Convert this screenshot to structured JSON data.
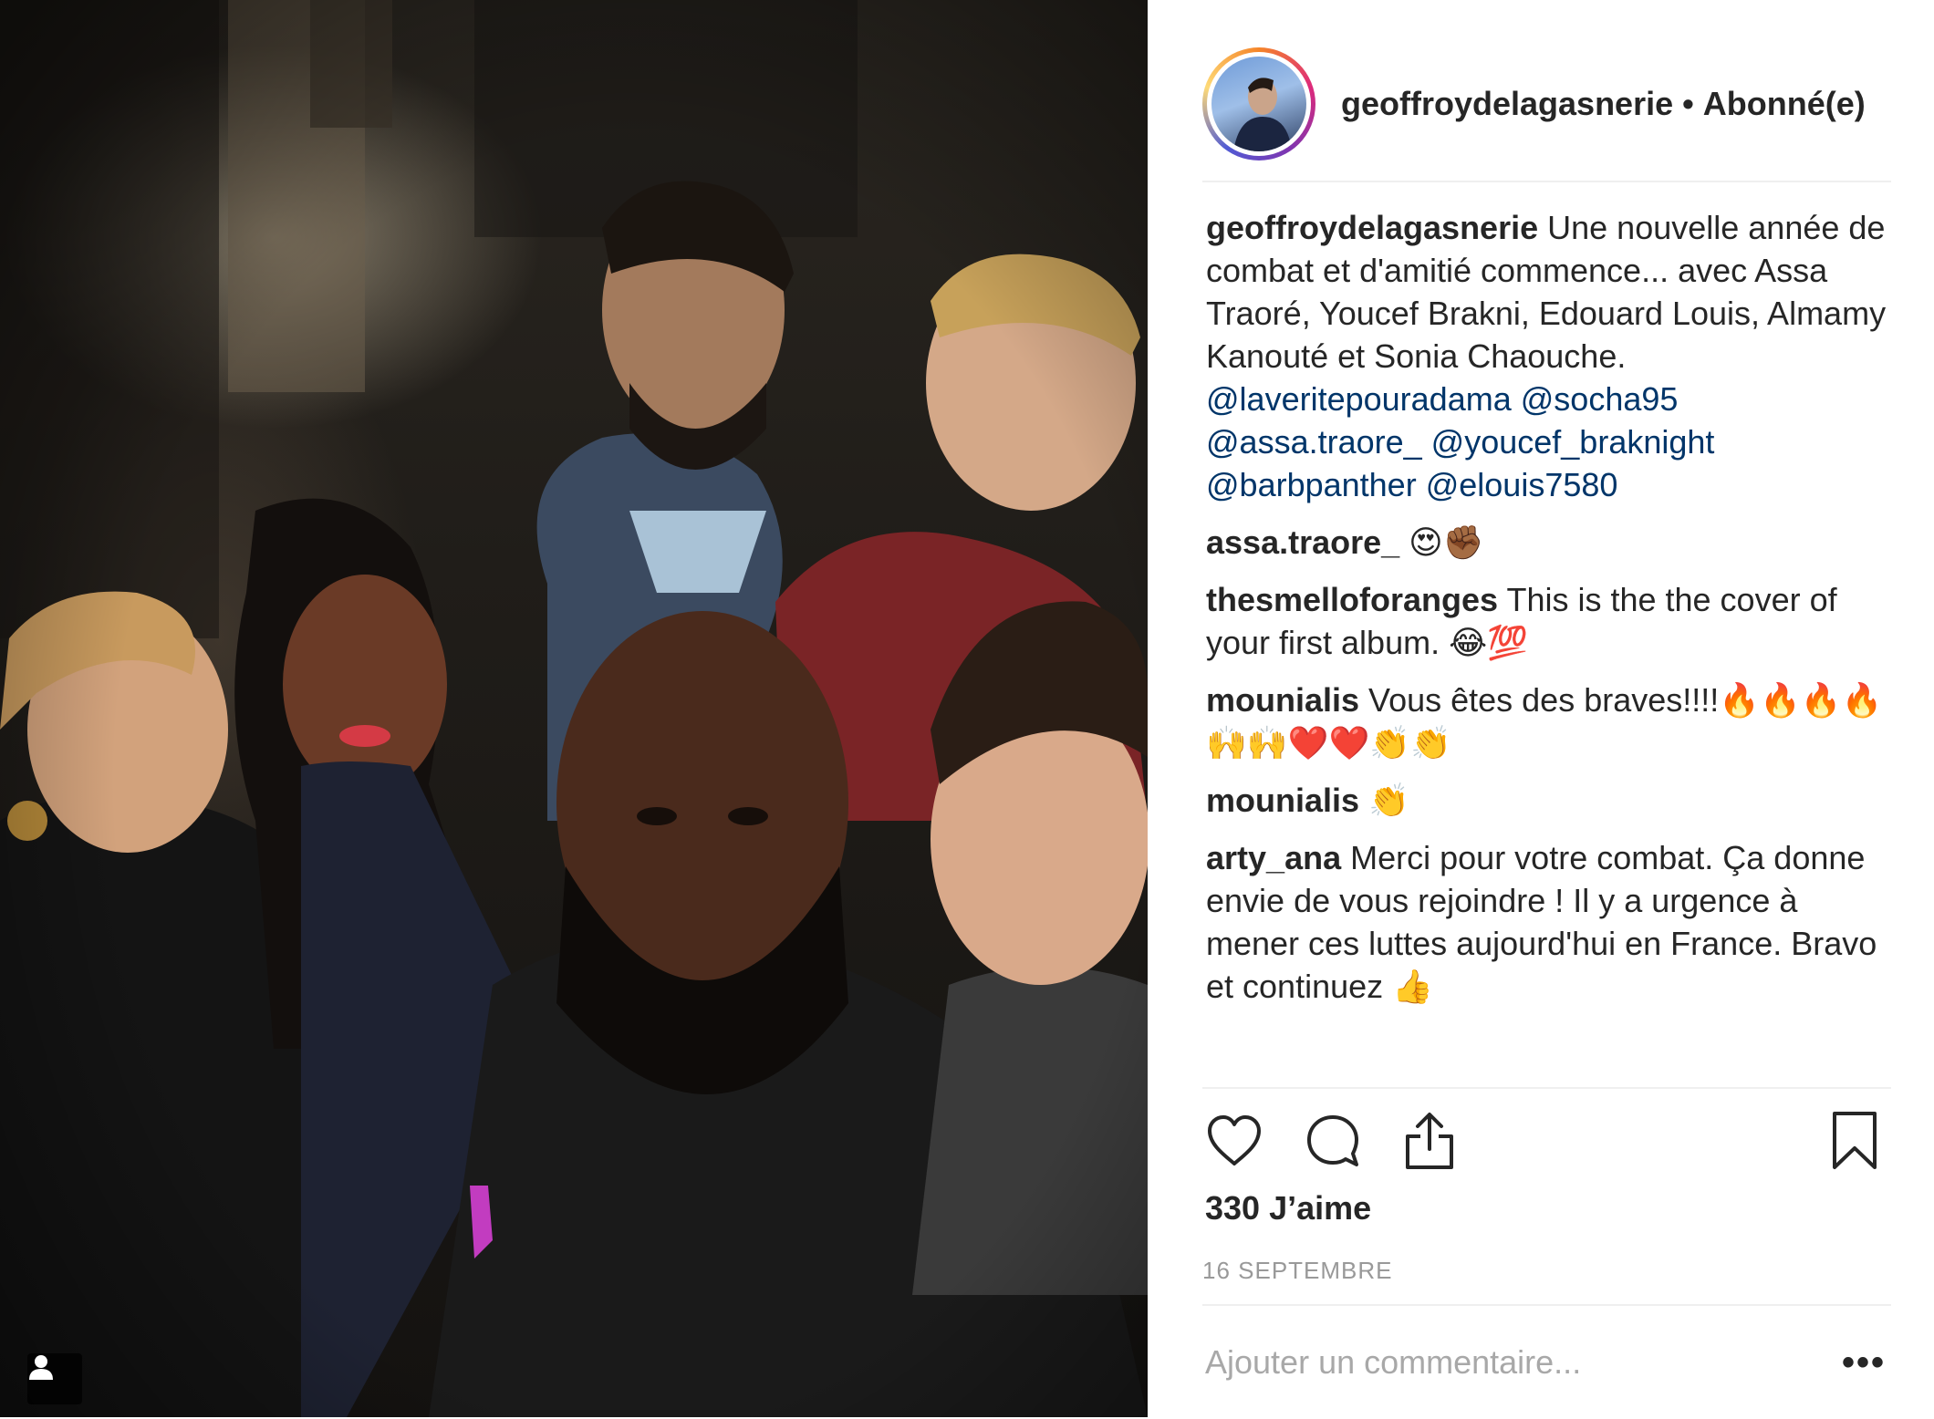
{
  "post": {
    "photo_alt": "Selfie de groupe de nuit",
    "author": "geoffroydelagasnerie",
    "separator": "•",
    "follow_status": "Abonné(e)",
    "caption": {
      "user": "geoffroydelagasnerie",
      "text": "Une nouvelle année de combat et d'amitié commence... avec Assa Traoré, Youcef Brakni, Edouard Louis, Almamy Kanouté et Sonia Chaouche.",
      "mentions": [
        "@laveritepouradama",
        "@socha95",
        "@assa.traore_",
        "@youcef_braknight",
        "@barbpanther",
        "@elouis7580"
      ]
    },
    "comments": [
      {
        "user": "assa.traore_",
        "text": "😍✊🏾"
      },
      {
        "user": "thesmelloforanges",
        "text": "This is the the cover of your first album. 😂💯"
      },
      {
        "user": "mounialis",
        "text": "Vous êtes des braves!!!!🔥🔥🔥🔥🙌🙌❤️❤️👏👏"
      },
      {
        "user": "mounialis",
        "text": "👏"
      },
      {
        "user": "arty_ana",
        "text": "Merci pour votre combat. Ça donne envie de vous rejoindre ! Il y a urgence à mener ces luttes aujourd'hui en France. Bravo et continuez 👍"
      }
    ],
    "likes": "330 J’aime",
    "date": "16 SEPTEMBRE",
    "comment_placeholder": "Ajouter un commentaire...",
    "more_label": "•••",
    "icons": {
      "like": "heart-icon",
      "comment": "comment-bubble-icon",
      "share": "share-icon",
      "save": "bookmark-icon",
      "tag": "user-tag-icon"
    }
  }
}
